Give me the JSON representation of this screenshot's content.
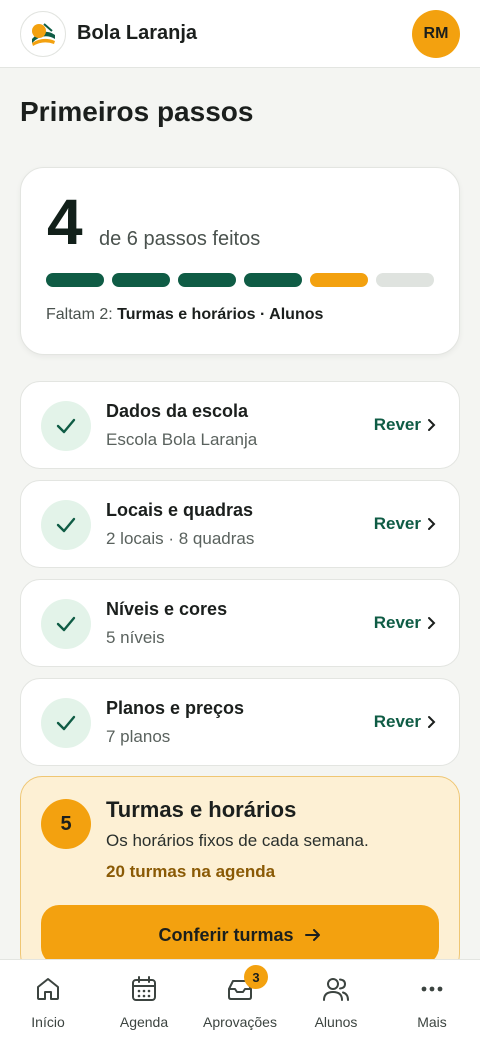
{
  "header": {
    "app_name": "Bola Laranja",
    "avatar_initials": "RM"
  },
  "page": {
    "title": "Primeiros passos"
  },
  "progress": {
    "done": "4",
    "label": "de 6 passos feitos",
    "total_steps": 6,
    "completed_steps": 4,
    "remaining_prefix": "Faltam 2:",
    "remaining_items": "Turmas e horários · Alunos"
  },
  "steps": [
    {
      "title": "Dados da escola",
      "subtitle": "Escola Bola Laranja",
      "action": "Rever"
    },
    {
      "title": "Locais e quadras",
      "subtitle": "2 locais · 8 quadras",
      "action": "Rever"
    },
    {
      "title": "Níveis e cores",
      "subtitle": "5 níveis",
      "action": "Rever"
    },
    {
      "title": "Planos e preços",
      "subtitle": "7 planos",
      "action": "Rever"
    }
  ],
  "active_step": {
    "number": "5",
    "title": "Turmas e horários",
    "description": "Os horários fixos de cada semana.",
    "count": "20 turmas na agenda",
    "cta": "Conferir turmas"
  },
  "nav": [
    {
      "label": "Início",
      "icon": "home-icon"
    },
    {
      "label": "Agenda",
      "icon": "calendar-icon"
    },
    {
      "label": "Aprovações",
      "icon": "inbox-icon",
      "badge": "3"
    },
    {
      "label": "Alunos",
      "icon": "users-icon"
    },
    {
      "label": "Mais",
      "icon": "more-icon"
    }
  ],
  "colors": {
    "accent": "#f3a10f",
    "brand": "#0f5c45",
    "done_bg": "#e3f3e9"
  }
}
